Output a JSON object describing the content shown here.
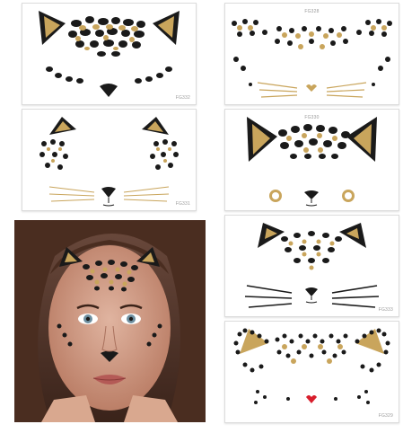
{
  "colors": {
    "background": "#ffffff",
    "gold": "#c9a55c",
    "black": "#1a1a1a",
    "red_gem": "#d81e2c",
    "skin": "#c99480",
    "hair": "#4a2d20"
  },
  "cards": [
    {
      "id": "card-1",
      "code": "FG332"
    },
    {
      "id": "card-2",
      "code": "FG328"
    },
    {
      "id": "card-3",
      "code": "FG331"
    },
    {
      "id": "card-4",
      "code": "FG330"
    },
    {
      "id": "card-5",
      "code": "FG333"
    },
    {
      "id": "card-6",
      "code": "FG329"
    }
  ],
  "photo": {
    "subject": "model-wearing-leopard-face-gems"
  }
}
